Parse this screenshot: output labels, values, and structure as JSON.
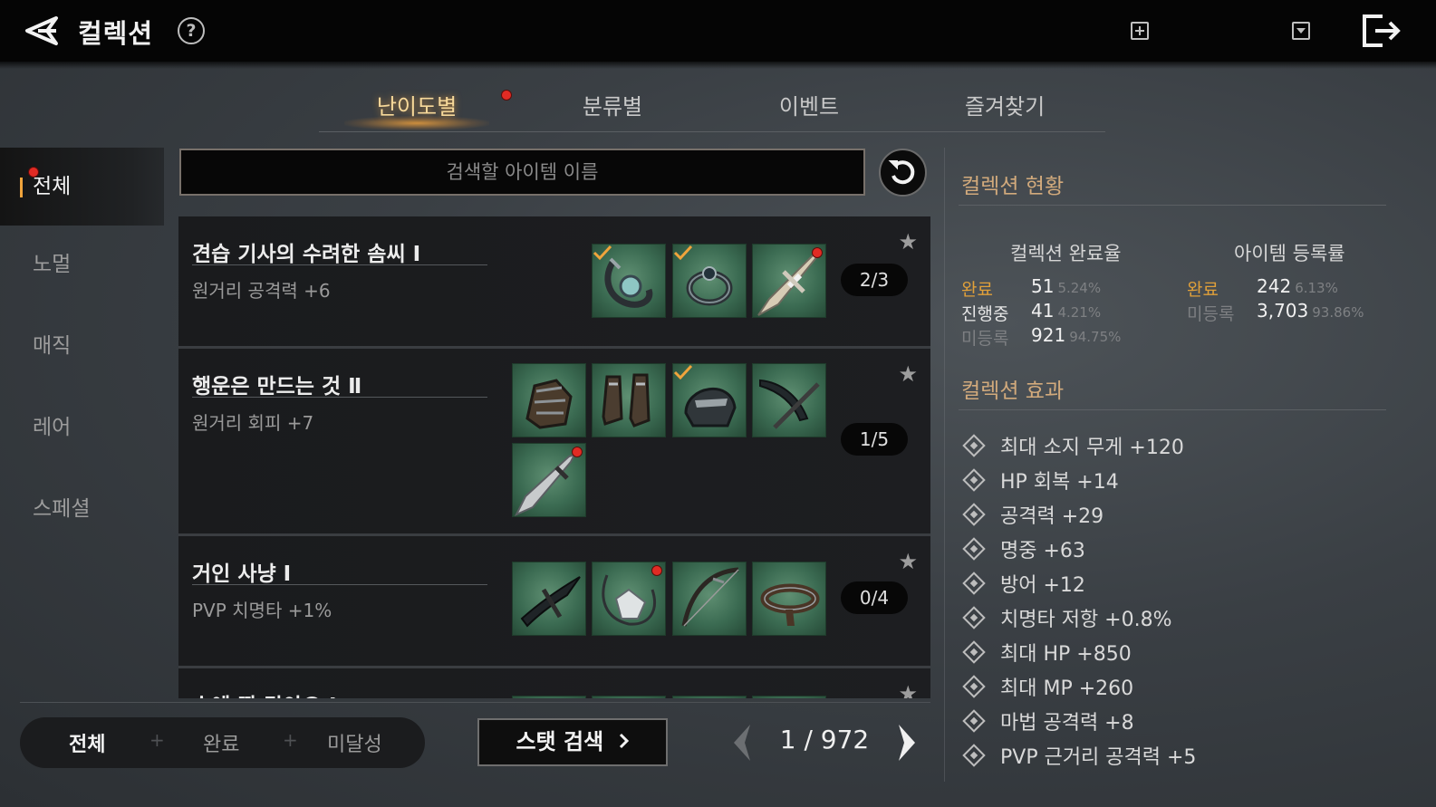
{
  "header": {
    "title": "컬렉션",
    "help_label": "?"
  },
  "tabs": [
    {
      "label": "난이도별",
      "active": true,
      "has_notification": true
    },
    {
      "label": "분류별"
    },
    {
      "label": "이벤트"
    },
    {
      "label": "즐겨찾기"
    }
  ],
  "sidebar": {
    "items": [
      {
        "label": "전체",
        "active": true
      },
      {
        "label": "노멀"
      },
      {
        "label": "매직",
        "has_notification": true
      },
      {
        "label": "레어"
      },
      {
        "label": "스페셜"
      }
    ]
  },
  "search": {
    "placeholder": "검색할 아이템 이름"
  },
  "collections": [
    {
      "title": "견습 기사의 수려한 솜씨 Ⅰ",
      "effect": "원거리 공격력 +6",
      "count": "2/3",
      "items": [
        {
          "icon": "amulet-icon",
          "registered": true
        },
        {
          "icon": "ring-icon",
          "registered": true
        },
        {
          "icon": "sword-icon",
          "notification": true
        }
      ]
    },
    {
      "title": "행운은 만드는 것 Ⅱ",
      "effect": "원거리 회피 +7",
      "count": "1/5",
      "items": [
        {
          "icon": "gauntlet-icon"
        },
        {
          "icon": "boots-icon"
        },
        {
          "icon": "helmet-icon",
          "registered": true
        },
        {
          "icon": "scythe-icon"
        },
        {
          "icon": "greatsword-icon",
          "notification": true
        }
      ]
    },
    {
      "title": "거인 사냥 Ⅰ",
      "effect": "PVP 치명타 +1%",
      "count": "0/4",
      "items": [
        {
          "icon": "blade-icon"
        },
        {
          "icon": "necklace-icon",
          "notification": true
        },
        {
          "icon": "bow-icon"
        },
        {
          "icon": "belt-icon"
        }
      ]
    },
    {
      "title": "손에 딱 맞아요 Ⅰ"
    }
  ],
  "filter": {
    "all": "전체",
    "done": "완료",
    "incomplete": "미달성",
    "separator": "+"
  },
  "stat_search_label": "스탯 검색",
  "pager": {
    "text": "1 / 972"
  },
  "status": {
    "title": "컬렉션 현황",
    "completion_head": "컬렉션 완료율",
    "registration_head": "아이템 등록률",
    "completion": [
      {
        "label": "완료",
        "value": "51",
        "pct": "5.24%",
        "color": "#e0a03a"
      },
      {
        "label": "진행중",
        "value": "41",
        "pct": "4.21%",
        "color": "#e6e6e6"
      },
      {
        "label": "미등록",
        "value": "921",
        "pct": "94.75%",
        "color": "#7d7f82"
      }
    ],
    "registration": [
      {
        "label": "완료",
        "value": "242",
        "pct": "6.13%",
        "color": "#e0a03a"
      },
      {
        "label": "미등록",
        "value": "3,703",
        "pct": "93.86%",
        "color": "#7d7f82"
      }
    ]
  },
  "effects": {
    "title": "컬렉션 효과",
    "items": [
      "최대 소지 무게 +120",
      "HP 회복 +14",
      "공격력 +29",
      "명중 +63",
      "방어 +12",
      "치명타 저항 +0.8%",
      "최대 HP +850",
      "최대 MP +260",
      "마법 공격력 +8",
      "PVP 근거리 공격력 +5"
    ]
  },
  "colors": {
    "accent_gold": "#f0a43c",
    "tab_active": "#f7d99a",
    "notification_red": "#e12b24",
    "slot_green": "#3b6b52",
    "check_orange": "#f0a43c"
  }
}
